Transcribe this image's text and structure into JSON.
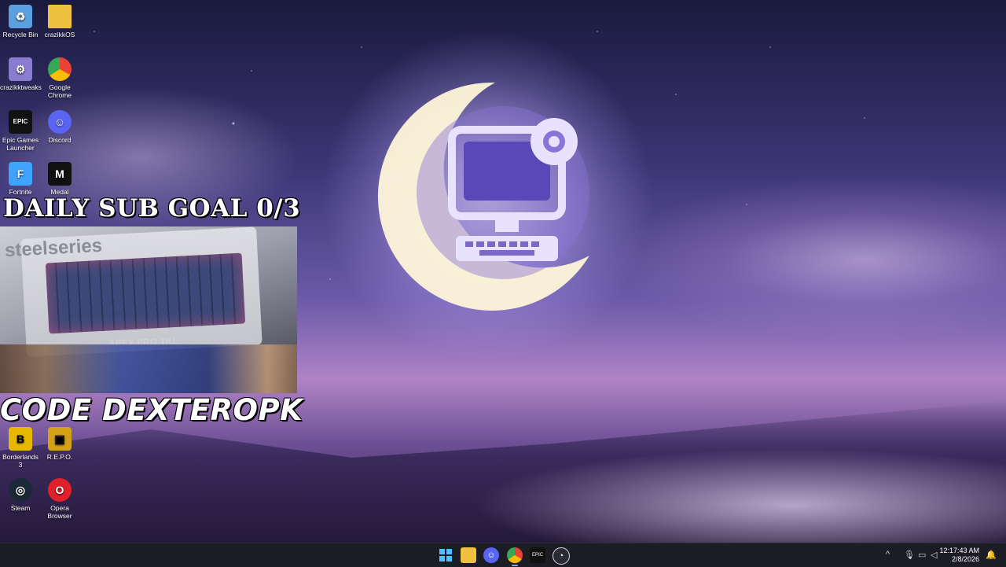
{
  "desktop": {
    "icons": [
      {
        "label": "Recycle Bin",
        "icon": "recycle-bin-icon",
        "glyph": "♻",
        "color": "#5aa0e0"
      },
      {
        "label": "crazikkOS",
        "icon": "folder-icon",
        "glyph": "",
        "color": "#f0c040"
      },
      {
        "label": "crazikktweaks",
        "icon": "tweaks-app-icon",
        "glyph": "⚙",
        "color": "#8a7cd0"
      },
      {
        "label": "Google Chrome",
        "icon": "chrome-icon",
        "glyph": "◉",
        "color": "#34a853"
      },
      {
        "label": "Epic Games Launcher",
        "icon": "epic-games-icon",
        "glyph": "EPIC",
        "color": "#111111"
      },
      {
        "label": "Discord",
        "icon": "discord-icon",
        "glyph": "☺",
        "color": "#5865f2"
      },
      {
        "label": "Fortnite",
        "icon": "fortnite-icon",
        "glyph": "F",
        "color": "#3fa3ff"
      },
      {
        "label": "Medal",
        "icon": "medal-icon",
        "glyph": "M",
        "color": "#111111"
      },
      {
        "label": "Borderlands 3",
        "icon": "borderlands-icon",
        "glyph": "B",
        "color": "#e6b800"
      },
      {
        "label": "R.E.P.O.",
        "icon": "repo-icon",
        "glyph": "▣",
        "color": "#d4a017"
      },
      {
        "label": "Steam",
        "icon": "steam-icon",
        "glyph": "◎",
        "color": "#1b2838"
      },
      {
        "label": "Opera Browser",
        "icon": "opera-icon",
        "glyph": "O",
        "color": "#e0202a"
      }
    ]
  },
  "overlays": {
    "goal_text": "DAILY SUB GOAL 0/3",
    "code_text": "CODE DEXTEROPK",
    "webcam": {
      "brand": "steelseries",
      "model": "APEX PRO TKL"
    }
  },
  "taskbar": {
    "apps": [
      {
        "name": "start",
        "icon": "windows-start-icon"
      },
      {
        "name": "file-explorer",
        "icon": "folder-icon"
      },
      {
        "name": "discord",
        "icon": "discord-icon"
      },
      {
        "name": "chrome",
        "icon": "chrome-icon"
      },
      {
        "name": "epic-games",
        "icon": "epic-games-icon"
      },
      {
        "name": "obs",
        "icon": "obs-icon"
      }
    ],
    "clock": {
      "time": "12:17:43 AM",
      "date": "2/8/2026"
    }
  }
}
